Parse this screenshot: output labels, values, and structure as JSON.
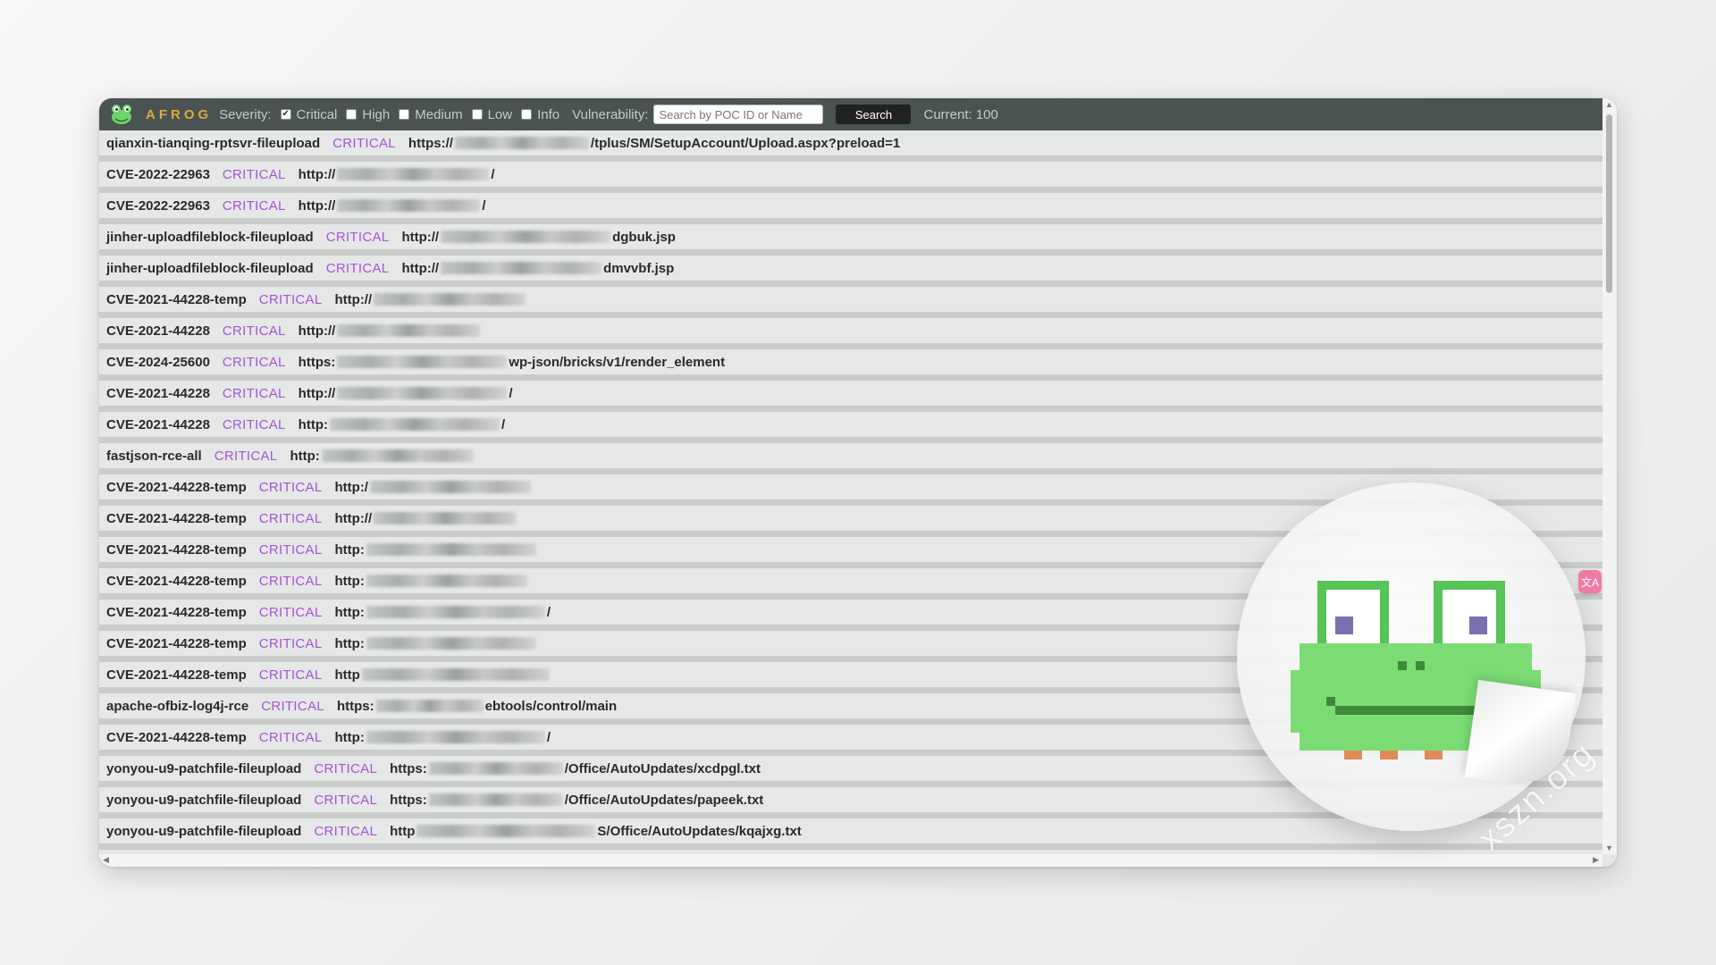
{
  "toolbar": {
    "brand": "AFROG",
    "severity_label": "Severity:",
    "severities": [
      {
        "label": "Critical",
        "checked": true
      },
      {
        "label": "High",
        "checked": false
      },
      {
        "label": "Medium",
        "checked": false
      },
      {
        "label": "Low",
        "checked": false
      },
      {
        "label": "Info",
        "checked": false
      }
    ],
    "vuln_label": "Vulnerability:",
    "search_placeholder": "Search by POC ID or Name",
    "search_button": "Search",
    "current": "Current: 100"
  },
  "rows": [
    {
      "poc": "qianxin-tianqing-rptsvr-fileupload",
      "severity": "CRITICAL",
      "prefix": "https://",
      "suffix": "/tplus/SM/SetupAccount/Upload.aspx?preload=1"
    },
    {
      "poc": "CVE-2022-22963",
      "severity": "CRITICAL",
      "prefix": "http://",
      "suffix": "/"
    },
    {
      "poc": "CVE-2022-22963",
      "severity": "CRITICAL",
      "prefix": "http://",
      "suffix": "/"
    },
    {
      "poc": "jinher-uploadfileblock-fileupload",
      "severity": "CRITICAL",
      "prefix": "http://",
      "suffix": "dgbuk.jsp"
    },
    {
      "poc": "jinher-uploadfileblock-fileupload",
      "severity": "CRITICAL",
      "prefix": "http://",
      "suffix": "dmvvbf.jsp"
    },
    {
      "poc": "CVE-2021-44228-temp",
      "severity": "CRITICAL",
      "prefix": "http://",
      "suffix": ""
    },
    {
      "poc": "CVE-2021-44228",
      "severity": "CRITICAL",
      "prefix": "http://",
      "suffix": ""
    },
    {
      "poc": "CVE-2024-25600",
      "severity": "CRITICAL",
      "prefix": "https:",
      "suffix": "wp-json/bricks/v1/render_element"
    },
    {
      "poc": "CVE-2021-44228",
      "severity": "CRITICAL",
      "prefix": "http://",
      "suffix": "/"
    },
    {
      "poc": "CVE-2021-44228",
      "severity": "CRITICAL",
      "prefix": "http:",
      "suffix": "/"
    },
    {
      "poc": "fastjson-rce-all",
      "severity": "CRITICAL",
      "prefix": "http:",
      "suffix": ""
    },
    {
      "poc": "CVE-2021-44228-temp",
      "severity": "CRITICAL",
      "prefix": "http:/",
      "suffix": ""
    },
    {
      "poc": "CVE-2021-44228-temp",
      "severity": "CRITICAL",
      "prefix": "http://",
      "suffix": ""
    },
    {
      "poc": "CVE-2021-44228-temp",
      "severity": "CRITICAL",
      "prefix": "http:",
      "suffix": ""
    },
    {
      "poc": "CVE-2021-44228-temp",
      "severity": "CRITICAL",
      "prefix": "http:",
      "suffix": ""
    },
    {
      "poc": "CVE-2021-44228-temp",
      "severity": "CRITICAL",
      "prefix": "http:",
      "suffix": "/"
    },
    {
      "poc": "CVE-2021-44228-temp",
      "severity": "CRITICAL",
      "prefix": "http:",
      "suffix": ""
    },
    {
      "poc": "CVE-2021-44228-temp",
      "severity": "CRITICAL",
      "prefix": "http",
      "suffix": ""
    },
    {
      "poc": "apache-ofbiz-log4j-rce",
      "severity": "CRITICAL",
      "prefix": "https:",
      "suffix": "ebtools/control/main"
    },
    {
      "poc": "CVE-2021-44228-temp",
      "severity": "CRITICAL",
      "prefix": "http:",
      "suffix": "/"
    },
    {
      "poc": "yonyou-u9-patchfile-fileupload",
      "severity": "CRITICAL",
      "prefix": "https:",
      "suffix": "/Office/AutoUpdates/xcdpgl.txt"
    },
    {
      "poc": "yonyou-u9-patchfile-fileupload",
      "severity": "CRITICAL",
      "prefix": "https:",
      "suffix": "/Office/AutoUpdates/papeek.txt"
    },
    {
      "poc": "yonyou-u9-patchfile-fileupload",
      "severity": "CRITICAL",
      "prefix": "http",
      "suffix": "S/Office/AutoUpdates/kqajxg.txt"
    }
  ],
  "watermark": "xszn.org",
  "translate_label": "文A"
}
